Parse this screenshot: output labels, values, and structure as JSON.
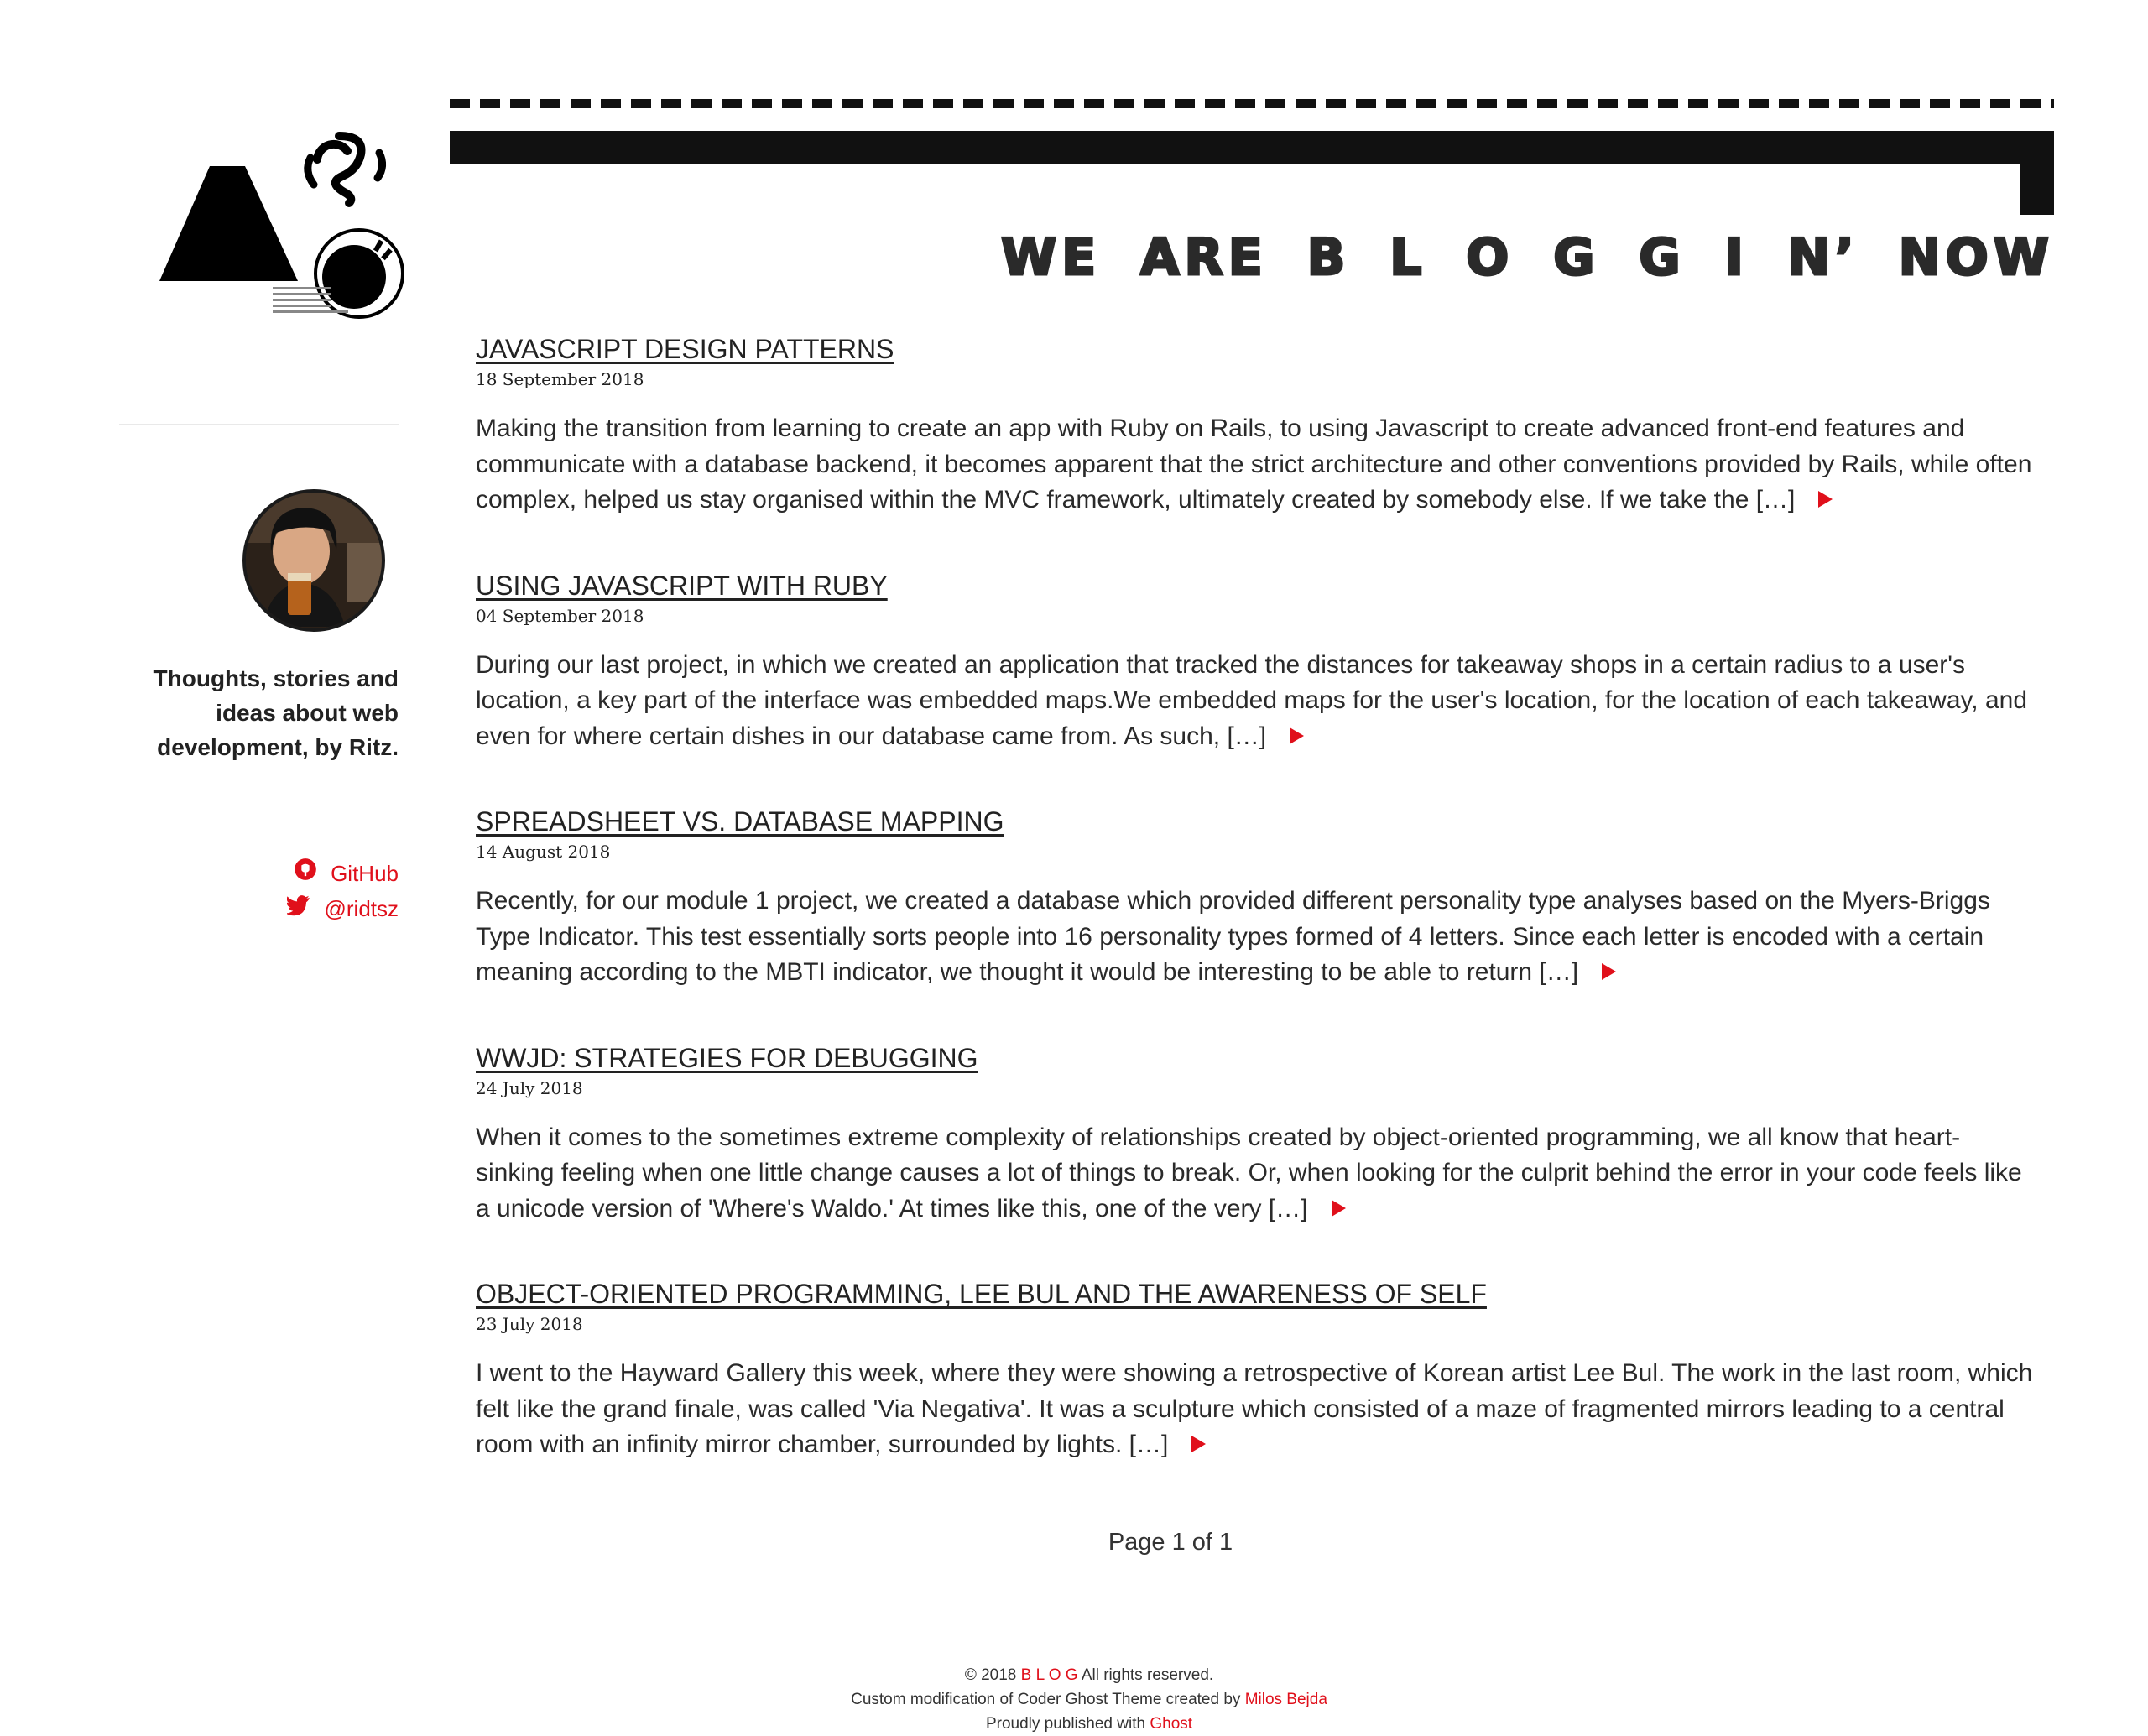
{
  "header": {
    "title": "WE ARE B L O G G I N’ NOW"
  },
  "sidebar": {
    "tagline": "Thoughts, stories and ideas about web development, by Ritz.",
    "links": [
      {
        "label": "GitHub",
        "icon": "github-icon"
      },
      {
        "label": "@ridtsz",
        "icon": "twitter-icon"
      }
    ]
  },
  "posts": [
    {
      "title": "JAVASCRIPT DESIGN PATTERNS",
      "date": "18 September 2018",
      "excerpt": "Making the transition from learning to create an app with Ruby on Rails, to using Javascript to create advanced front-end features and communicate with a database backend, it becomes apparent that the strict architecture and other conventions provided by Rails, while often complex, helped us stay organised within the MVC framework, ultimately created by somebody else. If we take the […]"
    },
    {
      "title": "USING JAVASCRIPT WITH RUBY",
      "date": "04 September 2018",
      "excerpt": "During our last project, in which we created an application that tracked the distances for takeaway shops in a certain radius to a user's location, a key part of the interface was embedded maps.We embedded maps for the user's location, for the location of each takeaway, and even for where certain dishes in our database came from. As such, […]"
    },
    {
      "title": "SPREADSHEET VS. DATABASE MAPPING",
      "date": "14 August 2018",
      "excerpt": "Recently, for our module 1 project, we created a database which provided different personality type analyses based on the Myers-Briggs Type Indicator. This test essentially sorts people into 16 personality types formed of 4 letters. Since each letter is encoded with a certain meaning according to the MBTI indicator, we thought it would be interesting to be able to return […]"
    },
    {
      "title": "WWJD: STRATEGIES FOR DEBUGGING",
      "date": "24 July 2018",
      "excerpt": "When it comes to the sometimes extreme complexity of relationships created by object-oriented programming, we all know that heart-sinking feeling when one little change causes a lot of things to break. Or, when looking for the culprit behind the error in your code feels like a unicode version of 'Where's Waldo.' At times like this, one of the very […]"
    },
    {
      "title": "OBJECT-ORIENTED PROGRAMMING, LEE BUL AND THE AWARENESS OF SELF",
      "date": "23 July 2018",
      "excerpt": "I went to the Hayward Gallery this week, where they were showing a retrospective of Korean artist Lee Bul. The work in the last room, which felt like the grand finale, was called 'Via Negativa'. It was a sculpture which consisted of a maze of fragmented mirrors leading to a central room with an infinity mirror chamber, surrounded by lights. […]"
    }
  ],
  "pagination": {
    "text": "Page 1 of 1"
  },
  "footer": {
    "copyright_prefix": "© 2018",
    "site_name": "B L O G",
    "copyright_suffix": "All rights reserved.",
    "credit_prefix": "Custom modification of Coder Ghost Theme created by",
    "credit_author": "Milos Bejda",
    "published_prefix": "Proudly published with",
    "published_link": "Ghost"
  },
  "colors": {
    "accent": "#e0101b",
    "text": "#222222",
    "background": "#ffffff"
  }
}
